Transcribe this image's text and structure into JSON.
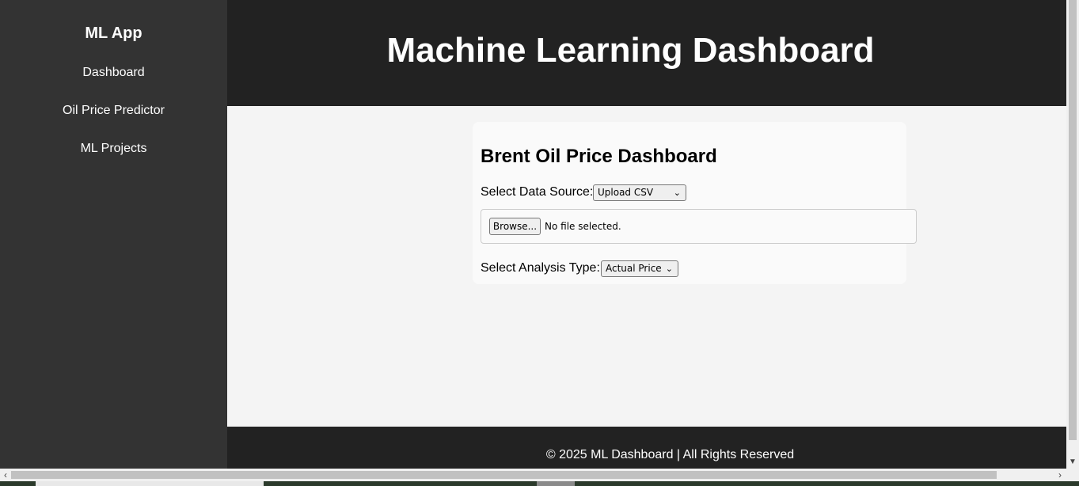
{
  "sidebar": {
    "brand": "ML App",
    "items": [
      {
        "label": "Dashboard"
      },
      {
        "label": "Oil Price Predictor"
      },
      {
        "label": "ML Projects"
      }
    ]
  },
  "header": {
    "title": "Machine Learning Dashboard"
  },
  "card": {
    "title": "Brent Oil Price Dashboard",
    "data_source_label": "Select Data Source:",
    "data_source_value": "Upload CSV",
    "browse_label": "Browse...",
    "file_status": "No file selected.",
    "analysis_label": "Select Analysis Type:",
    "analysis_value": "Actual Price"
  },
  "footer": {
    "text": "© 2025 ML Dashboard | All Rights Reserved"
  },
  "icons": {
    "dropdown": "chevron-down-icon",
    "scroll_up": "chevron-up-icon",
    "scroll_down": "chevron-down-icon",
    "scroll_left": "chevron-left-icon",
    "scroll_right": "chevron-right-icon"
  },
  "colors": {
    "sidebar_bg": "#333333",
    "header_bg": "#222222",
    "main_bg": "#f4f4f4",
    "card_bg": "#fafafa"
  }
}
